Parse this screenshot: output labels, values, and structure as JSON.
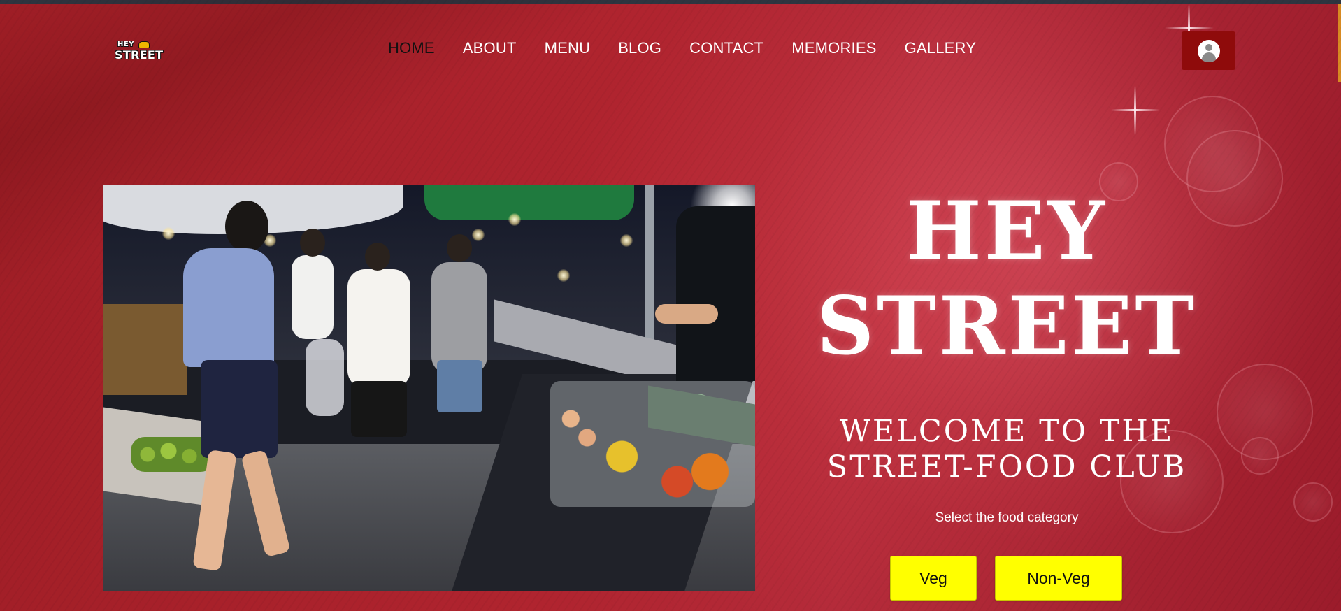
{
  "logo": {
    "line1": "HEY",
    "line2": "STREET"
  },
  "nav": {
    "items": [
      {
        "label": "HOME",
        "active": true
      },
      {
        "label": "ABOUT",
        "active": false
      },
      {
        "label": "MENU",
        "active": false
      },
      {
        "label": "BLOG",
        "active": false
      },
      {
        "label": "CONTACT",
        "active": false
      },
      {
        "label": "MEMORIES",
        "active": false
      },
      {
        "label": "GALLERY",
        "active": false
      }
    ]
  },
  "user_button": {
    "icon": "user-avatar-icon"
  },
  "hero": {
    "title_line1": "HEY",
    "title_line2": "STREET",
    "subtitle_line1": "WELCOME TO THE",
    "subtitle_line2": "STREET-FOOD CLUB",
    "prompt": "Select the food category",
    "buttons": {
      "veg": "Veg",
      "nonveg": "Non-Veg"
    }
  },
  "colors": {
    "background": "#b0242f",
    "user_button": "#8f0b0b",
    "category_button": "#ffff00",
    "active_nav": "#111111",
    "nav_text": "#ffffff"
  }
}
